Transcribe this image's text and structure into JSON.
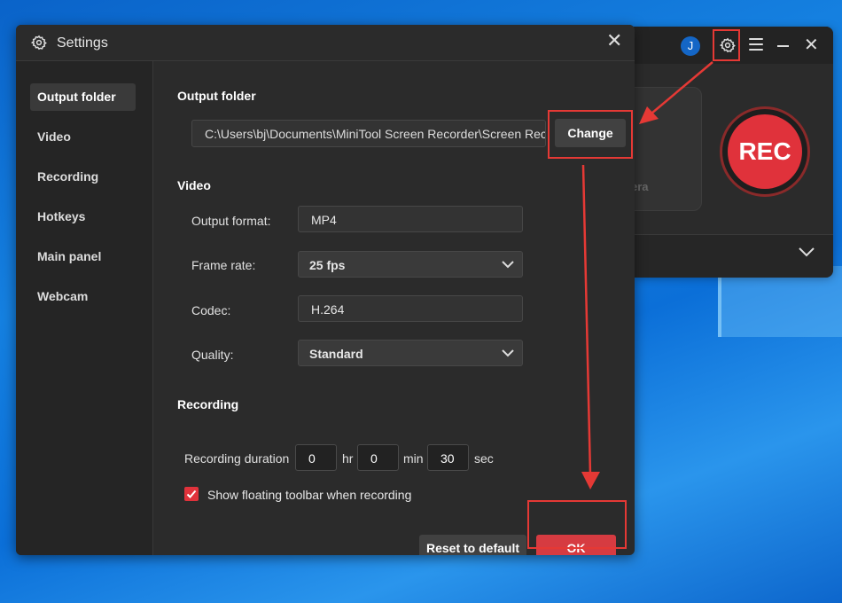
{
  "recorder": {
    "avatar_initial": "J",
    "camera_label": "era",
    "rec_label": "REC"
  },
  "dialog": {
    "title": "Settings"
  },
  "sidebar": {
    "items": [
      {
        "label": "Output folder",
        "active": true
      },
      {
        "label": "Video",
        "active": false
      },
      {
        "label": "Recording",
        "active": false
      },
      {
        "label": "Hotkeys",
        "active": false
      },
      {
        "label": "Main panel",
        "active": false
      },
      {
        "label": "Webcam",
        "active": false
      }
    ]
  },
  "output_folder": {
    "heading": "Output folder",
    "path": "C:\\Users\\bj\\Documents\\MiniTool Screen Recorder\\Screen Rec",
    "change_label": "Change"
  },
  "video": {
    "heading": "Video",
    "format_label": "Output format:",
    "format_value": "MP4",
    "framerate_label": "Frame rate:",
    "framerate_value": "25 fps",
    "codec_label": "Codec:",
    "codec_value": "H.264",
    "quality_label": "Quality:",
    "quality_value": "Standard"
  },
  "recording": {
    "heading": "Recording",
    "duration_label": "Recording duration",
    "hours": "0",
    "hr_unit": "hr",
    "minutes": "0",
    "min_unit": "min",
    "seconds": "30",
    "sec_unit": "sec",
    "floating_toolbar_label": "Show floating toolbar when recording",
    "floating_toolbar_checked": true
  },
  "footer": {
    "reset_label": "Reset to default",
    "ok_label": "OK"
  },
  "colors": {
    "accent": "#e0323b",
    "highlight": "#e53935"
  }
}
